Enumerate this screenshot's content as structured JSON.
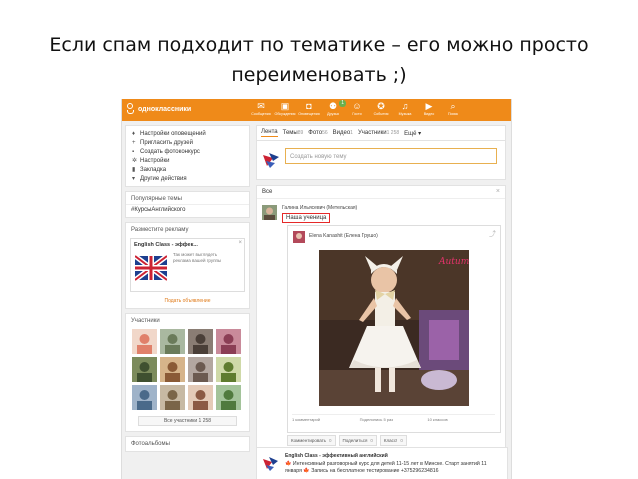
{
  "caption": {
    "line1": "Если спам подходит по тематике – его можно просто",
    "line2": "переименовать ;)"
  },
  "topbar": {
    "logo_text": "одноклассники",
    "nav": [
      {
        "label": "Сообщения",
        "icon": "envelope-icon",
        "glyph": "✉"
      },
      {
        "label": "Обсуждения",
        "icon": "chat-icon",
        "glyph": "▣"
      },
      {
        "label": "Оповещения",
        "icon": "bell-icon",
        "glyph": "◘"
      },
      {
        "label": "Друзья",
        "icon": "friends-icon",
        "glyph": "⚉",
        "badge": "1"
      },
      {
        "label": "Гости",
        "icon": "guests-icon",
        "glyph": "☺"
      },
      {
        "label": "События",
        "icon": "events-icon",
        "glyph": "✪"
      },
      {
        "label": "Музыка",
        "icon": "music-icon",
        "glyph": "♫"
      },
      {
        "label": "Видео",
        "icon": "video-icon",
        "glyph": "▶"
      },
      {
        "label": "Поиск",
        "icon": "search-icon",
        "glyph": "⌕"
      }
    ],
    "color": "#ef8a19"
  },
  "sidebar": {
    "menu": [
      {
        "label": "Настройки оповещений",
        "icon": "bell-icon",
        "glyph": "♦"
      },
      {
        "label": "Пригласить друзей",
        "icon": "invite-icon",
        "glyph": "+"
      },
      {
        "label": "Создать фотоконкурс",
        "icon": "camera-icon",
        "glyph": "▪"
      },
      {
        "label": "Настройки",
        "icon": "gear-icon",
        "glyph": "✲"
      },
      {
        "label": "Закладка",
        "icon": "bookmark-icon",
        "glyph": "▮"
      },
      {
        "label": "Другие действия",
        "icon": "more-icon",
        "glyph": "▾"
      }
    ],
    "topics_title": "Популярные темы",
    "topic_tag": "#КурсыАнглийского",
    "ad_title": "Разместите рекламу",
    "ad_card_title": "English Class - эффек...",
    "ad_card_text": "Так может выглядеть реклама вашей группы",
    "ad_link": "Подать объявление",
    "members_title": "Участники",
    "members_button": "Все участники 1 258",
    "albums_title": "Фотоальбомы"
  },
  "tabs": [
    {
      "label": "Лента",
      "count": ""
    },
    {
      "label": "Темы",
      "count": "89"
    },
    {
      "label": "Фото",
      "count": "56"
    },
    {
      "label": "Видео",
      "count": "1"
    },
    {
      "label": "Участники",
      "count": "1 258"
    },
    {
      "label": "Ещё ▾",
      "count": ""
    }
  ],
  "composer_placeholder": "Создать новую тему",
  "feed": {
    "header": "Все",
    "author": "Галина Ильясевич (Метельская)",
    "group_label": "Наша ученица",
    "repost_author": "Elena Kanashit (Елена Грушо)",
    "stats": [
      "1 комментарий",
      "Поделились 5 раз",
      "10 классов"
    ],
    "actions": [
      {
        "label": "Комментировать",
        "count": "0"
      },
      {
        "label": "Поделиться",
        "count": "0"
      },
      {
        "label": "Класс!",
        "count": "0"
      }
    ]
  },
  "promo": {
    "title": "English Class - эффективный английский",
    "text": "🍁 Интенсивный разговорный курс для детей 11-15 лет в Минске. Старт занятий 11 января 🍁 Запись на бесплатное тестирование +375296234816"
  }
}
